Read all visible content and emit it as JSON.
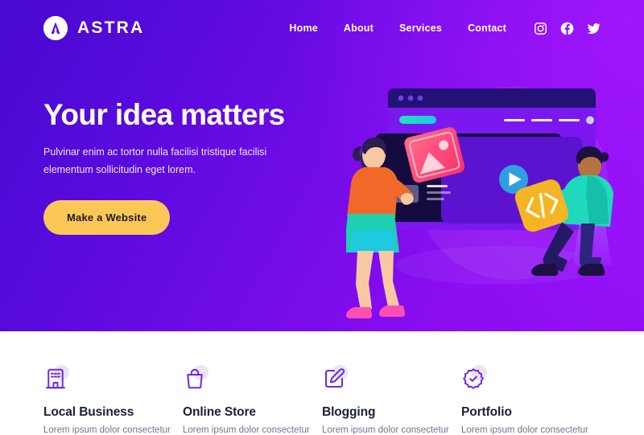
{
  "brand": {
    "name": "ASTRA",
    "logo_icon": "astra-logo-icon",
    "mark_color": "#ffffff"
  },
  "nav": {
    "links": [
      {
        "label": "Home"
      },
      {
        "label": "About"
      },
      {
        "label": "Services"
      },
      {
        "label": "Contact"
      }
    ],
    "socials": [
      {
        "name": "instagram-icon"
      },
      {
        "name": "facebook-icon"
      },
      {
        "name": "twitter-icon"
      }
    ]
  },
  "hero": {
    "title": "Your idea matters",
    "subtitle": "Pulvinar enim ac tortor nulla facilisi tristique facilisi elementum sollicitudin eget lorem.",
    "cta_label": "Make a Website",
    "cta_color": "#fbc858",
    "gradient_start": "#4709cf",
    "gradient_end": "#9410f8",
    "illustration": {
      "name": "website-builder-illustration",
      "browser_dots": 3,
      "accent_pill_color": "#17e0c8",
      "play_button_color": "#2f9fe0",
      "image_card_color": "#f9467e",
      "code_card_color": "#f5b423",
      "code_card_glyph": "</>"
    }
  },
  "features": [
    {
      "icon": "building-icon",
      "title": "Local Business",
      "desc": "Lorem ipsum dolor consectetur"
    },
    {
      "icon": "shopping-bag-icon",
      "title": "Online Store",
      "desc": "Lorem ipsum dolor consectetur"
    },
    {
      "icon": "pencil-edit-icon",
      "title": "Blogging",
      "desc": "Lorem ipsum dolor consectetur"
    },
    {
      "icon": "verified-badge-icon",
      "title": "Portfolio",
      "desc": "Lorem ipsum dolor consectetur"
    }
  ],
  "theme": {
    "icon_stroke": "#6d2ae2",
    "icon_blob": "#ece2fb",
    "title_color": "#1b2036",
    "desc_color": "#70768c"
  }
}
